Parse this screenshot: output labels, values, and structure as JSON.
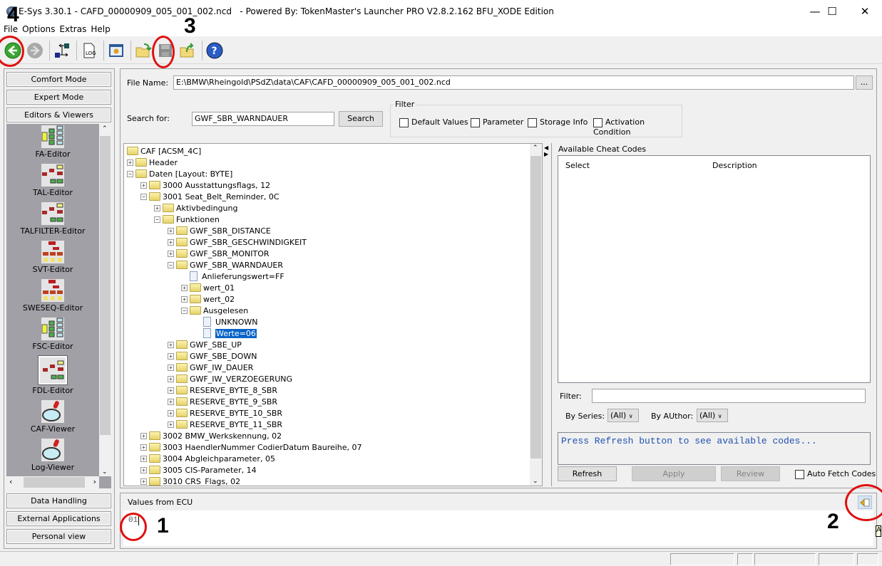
{
  "window": {
    "title": "E-Sys 3.30.1 - CAFD_00000909_005_001_002.ncd   - Powered By: TokenMaster's Launcher PRO V2.8.2.162 BFU_XODE Edition",
    "minimize": "—",
    "maximize": "☐",
    "close": "✕"
  },
  "menu": [
    "File",
    "Options",
    "Extras",
    "Help"
  ],
  "toolbar": {
    "icons": [
      "back-icon",
      "forward-icon",
      "connect-icon",
      "log-icon",
      "settings-window-icon",
      "open-folder-icon",
      "save-icon",
      "export-folder-icon",
      "help-icon"
    ],
    "help_glyph": "?"
  },
  "left_panel": {
    "top_buttons": [
      "Comfort Mode",
      "Expert Mode",
      "Editors & Viewers"
    ],
    "items": [
      "FA-Editor",
      "TAL-Editor",
      "TALFILTER-Editor",
      "SVT-Editor",
      "SWESEQ-Editor",
      "FSC-Editor",
      "FDL-Editor",
      "CAF-Viewer",
      "Log-Viewer"
    ],
    "selected_item": "FDL-Editor",
    "bottom_buttons": [
      "Data Handling",
      "External Applications",
      "Personal view"
    ]
  },
  "main": {
    "file_name_label": "File Name:",
    "file_name_value": "E:\\BMW\\Rheingold\\PSdZ\\data\\CAF\\CAFD_00000909_005_001_002.ncd",
    "browse_label": "...",
    "search_label": "Search for:",
    "search_value": "GWF_SBR_WARNDAUER",
    "search_button": "Search",
    "filter_title": "Filter",
    "filters": [
      "Default Values",
      "Parameter",
      "Storage Info",
      "Activation Condition"
    ]
  },
  "tree": [
    {
      "label": "CAF [ACSM_4C]",
      "level": 0,
      "type": "folder-open",
      "exp": ""
    },
    {
      "label": "Header",
      "level": 0,
      "type": "folder",
      "exp": "+"
    },
    {
      "label": "Daten [Layout: BYTE]",
      "level": 0,
      "type": "folder-open",
      "exp": "-"
    },
    {
      "label": "3000 Ausstattungsflags, 12",
      "level": 1,
      "type": "folder",
      "exp": "+"
    },
    {
      "label": "3001 Seat_Belt_Reminder, 0C",
      "level": 1,
      "type": "folder-open",
      "exp": "-"
    },
    {
      "label": "Aktivbedingung",
      "level": 2,
      "type": "folder",
      "exp": "+"
    },
    {
      "label": "Funktionen",
      "level": 2,
      "type": "folder-open",
      "exp": "-"
    },
    {
      "label": "GWF_SBR_DISTANCE",
      "level": 3,
      "type": "folder",
      "exp": "+"
    },
    {
      "label": "GWF_SBR_GESCHWINDIGKEIT",
      "level": 3,
      "type": "folder",
      "exp": "+"
    },
    {
      "label": "GWF_SBR_MONITOR",
      "level": 3,
      "type": "folder",
      "exp": "+"
    },
    {
      "label": "GWF_SBR_WARNDAUER",
      "level": 3,
      "type": "folder-open",
      "exp": "-"
    },
    {
      "label": "Anlieferungswert=FF",
      "level": 4,
      "type": "doc",
      "exp": ""
    },
    {
      "label": "wert_01",
      "level": 4,
      "type": "folder",
      "exp": "+"
    },
    {
      "label": "wert_02",
      "level": 4,
      "type": "folder",
      "exp": "+"
    },
    {
      "label": "Ausgelesen",
      "level": 4,
      "type": "folder-open",
      "exp": "-"
    },
    {
      "label": "UNKNOWN",
      "level": 5,
      "type": "doc",
      "exp": ""
    },
    {
      "label": "Werte=06",
      "level": 5,
      "type": "doc",
      "exp": "",
      "selected": true
    },
    {
      "label": "GWF_SBE_UP",
      "level": 3,
      "type": "folder",
      "exp": "+"
    },
    {
      "label": "GWF_SBE_DOWN",
      "level": 3,
      "type": "folder",
      "exp": "+"
    },
    {
      "label": "GWF_IW_DAUER",
      "level": 3,
      "type": "folder",
      "exp": "+"
    },
    {
      "label": "GWF_IW_VERZOEGERUNG",
      "level": 3,
      "type": "folder",
      "exp": "+"
    },
    {
      "label": "RESERVE_BYTE_8_SBR",
      "level": 3,
      "type": "folder",
      "exp": "+"
    },
    {
      "label": "RESERVE_BYTE_9_SBR",
      "level": 3,
      "type": "folder",
      "exp": "+"
    },
    {
      "label": "RESERVE_BYTE_10_SBR",
      "level": 3,
      "type": "folder",
      "exp": "+"
    },
    {
      "label": "RESERVE_BYTE_11_SBR",
      "level": 3,
      "type": "folder",
      "exp": "+"
    },
    {
      "label": "3002 BMW_Werkskennung, 02",
      "level": 1,
      "type": "folder",
      "exp": "+"
    },
    {
      "label": "3003 HaendlerNummer CodierDatum Baureihe, 07",
      "level": 1,
      "type": "folder",
      "exp": "+"
    },
    {
      "label": "3004 Abgleichparameter, 05",
      "level": 1,
      "type": "folder",
      "exp": "+"
    },
    {
      "label": "3005 CIS-Parameter, 14",
      "level": 1,
      "type": "folder",
      "exp": "+"
    },
    {
      "label": "3010 CRS_Flags, 02",
      "level": 1,
      "type": "folder",
      "exp": "+"
    }
  ],
  "cheat": {
    "title": "Available Cheat Codes",
    "col_select": "Select",
    "col_description": "Description",
    "filter_label": "Filter:",
    "filter_value": "",
    "series_label": "By Series:",
    "series_value": "(All)",
    "author_label": "By AUthor:",
    "author_value": "(All)",
    "message": "Press Refresh button to see available codes...",
    "refresh": "Refresh",
    "apply": "Apply",
    "review": "Review",
    "auto_fetch": "Auto Fetch Codes"
  },
  "ecu": {
    "label": "Values from ECU",
    "value": "01",
    "tooltip_fragment": "A"
  },
  "annotations": [
    "1",
    "2",
    "3",
    "4"
  ],
  "colors": {
    "selection": "#0a64c8",
    "annotation": "#e01010",
    "message": "#2050b0"
  }
}
